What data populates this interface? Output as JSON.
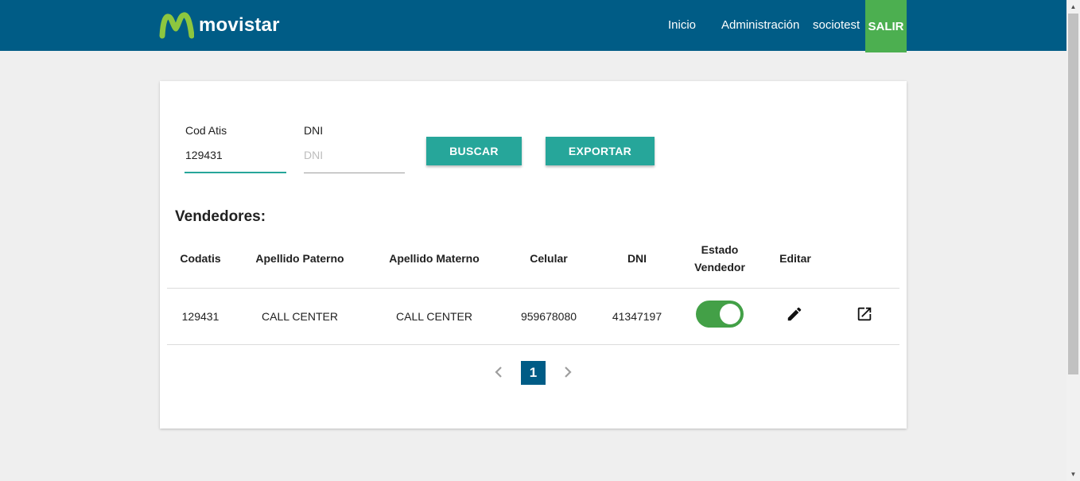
{
  "navbar": {
    "brand": "movistar",
    "links": [
      "Inicio",
      "Administración",
      "sociotest"
    ],
    "logout": "SALIR",
    "colors": {
      "bar": "#005c86",
      "logout": "#4caf50",
      "logo": "#8dc63f"
    }
  },
  "search": {
    "cod_atis_label": "Cod Atis",
    "cod_atis_value": "129431",
    "dni_label": "DNI",
    "dni_placeholder": "DNI",
    "buscar_label": "BUSCAR",
    "exportar_label": "EXPORTAR"
  },
  "table": {
    "title": "Vendedores:",
    "headers": [
      "Codatis",
      "Apellido Paterno",
      "Apellido Materno",
      "Celular",
      "DNI",
      "Estado Vendedor",
      "Editar"
    ],
    "rows": [
      {
        "codatis": "129431",
        "apellido_paterno": "CALL CENTER",
        "apellido_materno": "CALL CENTER",
        "celular": "959678080",
        "dni": "41347197",
        "estado_vendedor": "on",
        "edit_icon": "pencil-icon",
        "open_icon": "open-in-new-icon"
      }
    ]
  },
  "pagination": {
    "current_page": "1",
    "prev_icon": "chevron-left-icon",
    "next_icon": "chevron-right-icon"
  }
}
